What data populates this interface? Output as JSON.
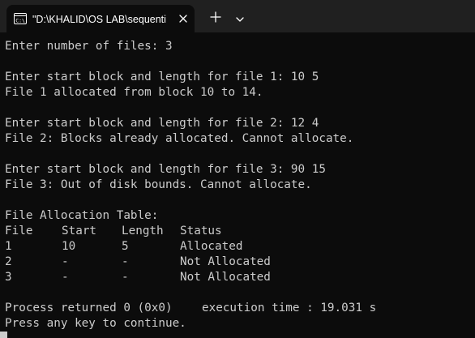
{
  "window": {
    "tab_title": "\"D:\\KHALID\\OS LAB\\sequenti",
    "icons": {
      "tab": "console-icon",
      "close": "close-icon",
      "new_tab": "plus-icon",
      "dropdown": "chevron-down-icon"
    }
  },
  "console": {
    "prompt_files": "Enter number of files: 3",
    "file1_prompt": "Enter start block and length for file 1: 10 5",
    "file1_result": "File 1 allocated from block 10 to 14.",
    "file2_prompt": "Enter start block and length for file 2: 12 4",
    "file2_result": "File 2: Blocks already allocated. Cannot allocate.",
    "file3_prompt": "Enter start block and length for file 3: 90 15",
    "file3_result": "File 3: Out of disk bounds. Cannot allocate.",
    "table_title": "File Allocation Table:",
    "table_headers": [
      "File",
      "Start",
      "Length",
      "Status"
    ],
    "table_rows": [
      [
        "1",
        "10",
        "5",
        "Allocated"
      ],
      [
        "2",
        "-",
        "-",
        "Not Allocated"
      ],
      [
        "3",
        "-",
        "-",
        "Not Allocated"
      ]
    ],
    "process_returned": "Process returned 0 (0x0)",
    "execution_time": "execution time : 19.031 s",
    "continue_prompt": "Press any key to continue."
  },
  "colors": {
    "background": "#0c0c0c",
    "tabstrip": "#202020",
    "text": "#cccccc"
  }
}
